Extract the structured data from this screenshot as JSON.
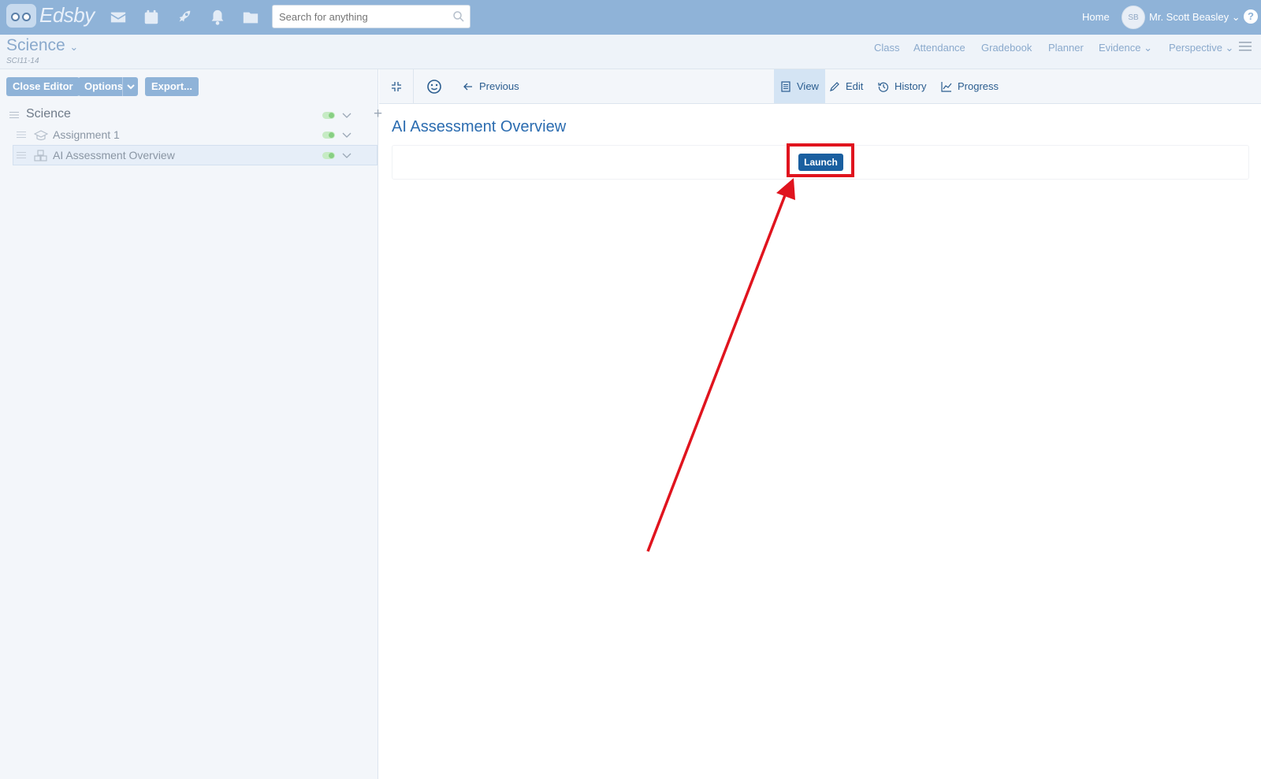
{
  "app": {
    "logo_text": "Edsby"
  },
  "topbar": {
    "search_placeholder": "Search for anything",
    "home_label": "Home",
    "avatar_initials": "SB",
    "user_name": "Mr. Scott Beasley",
    "help_label": "?",
    "icons": [
      "mail-icon",
      "calendar-icon",
      "rocket-icon",
      "bell-icon",
      "folder-icon",
      "search-icon"
    ]
  },
  "subheader": {
    "class_title": "Science",
    "class_code": "SCI11-14",
    "nav": {
      "class": "Class",
      "attendance": "Attendance",
      "gradebook": "Gradebook",
      "planner": "Planner",
      "evidence": "Evidence",
      "perspective": "Perspective"
    }
  },
  "leftpanel": {
    "close_editor": "Close Editor",
    "options": "Options",
    "export": "Export...",
    "tree": {
      "root": "Science",
      "items": [
        {
          "label": "Assignment 1",
          "icon": "graduation-cap-icon"
        },
        {
          "label": "AI Assessment Overview",
          "icon": "blocks-icon",
          "selected": true
        }
      ]
    }
  },
  "toolbar": {
    "previous": "Previous",
    "view": "View",
    "edit": "Edit",
    "history": "History",
    "progress": "Progress"
  },
  "content": {
    "title": "AI Assessment Overview",
    "launch": "Launch"
  },
  "colors": {
    "topbar": "#8fb3d8",
    "accent": "#2b6cb0",
    "button_primary": "#1a5fa0",
    "highlight": "#e0141e"
  }
}
